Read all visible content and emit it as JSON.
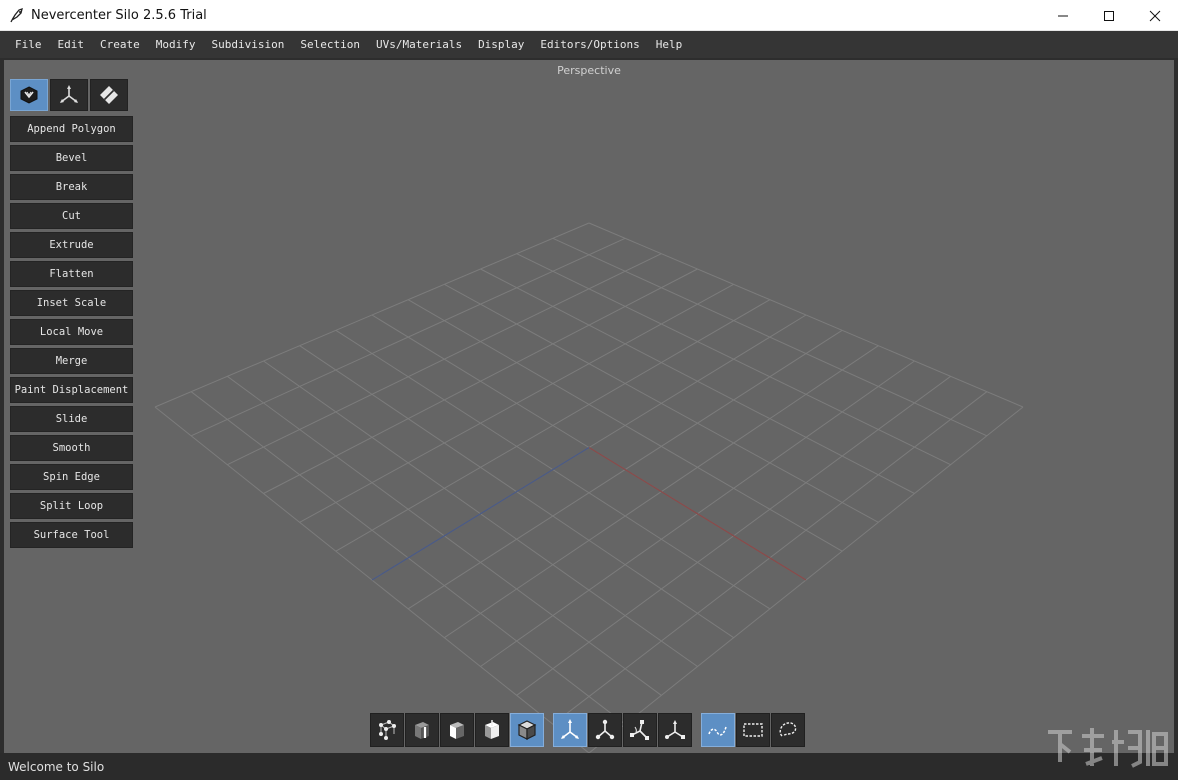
{
  "window": {
    "title": "Nevercenter Silo 2.5.6 Trial",
    "controls": [
      "minimize-icon",
      "maximize-icon",
      "close-icon"
    ]
  },
  "menu": [
    "File",
    "Edit",
    "Create",
    "Modify",
    "Subdivision",
    "Selection",
    "UVs/Materials",
    "Display",
    "Editors/Options",
    "Help"
  ],
  "viewport": {
    "label": "Perspective",
    "background": "#656565",
    "x_axis_color": "#8a4a4a",
    "z_axis_color": "#4a5a86"
  },
  "mode_buttons": [
    {
      "icon": "object-mode-icon",
      "active": true
    },
    {
      "icon": "transform-mode-icon",
      "active": false
    },
    {
      "icon": "uv-mode-icon",
      "active": false
    }
  ],
  "tools": [
    "Append Polygon",
    "Bevel",
    "Break",
    "Cut",
    "Extrude",
    "Flatten",
    "Inset Scale",
    "Local Move",
    "Merge",
    "Paint Displacement",
    "Slide",
    "Smooth",
    "Spin Edge",
    "Split Loop",
    "Surface Tool"
  ],
  "bottom_toolbar": {
    "selection_modes": [
      {
        "icon": "vertex-select-icon",
        "active": false
      },
      {
        "icon": "edge-select-icon",
        "active": false
      },
      {
        "icon": "face-select-icon",
        "active": false
      },
      {
        "icon": "object-select-icon",
        "active": false
      },
      {
        "icon": "solid-object-select-icon",
        "active": true
      }
    ],
    "manipulators": [
      {
        "icon": "move-manipulator-icon",
        "active": true
      },
      {
        "icon": "rotate-manipulator-icon",
        "active": false
      },
      {
        "icon": "scale-manipulator-icon",
        "active": false
      },
      {
        "icon": "universal-manipulator-icon",
        "active": false
      }
    ],
    "select_tools": [
      {
        "icon": "paint-select-icon",
        "active": true
      },
      {
        "icon": "rectangle-select-icon",
        "active": false
      },
      {
        "icon": "lasso-select-icon",
        "active": false
      }
    ]
  },
  "status": "Welcome to Silo",
  "accent": "#5d8fc4"
}
